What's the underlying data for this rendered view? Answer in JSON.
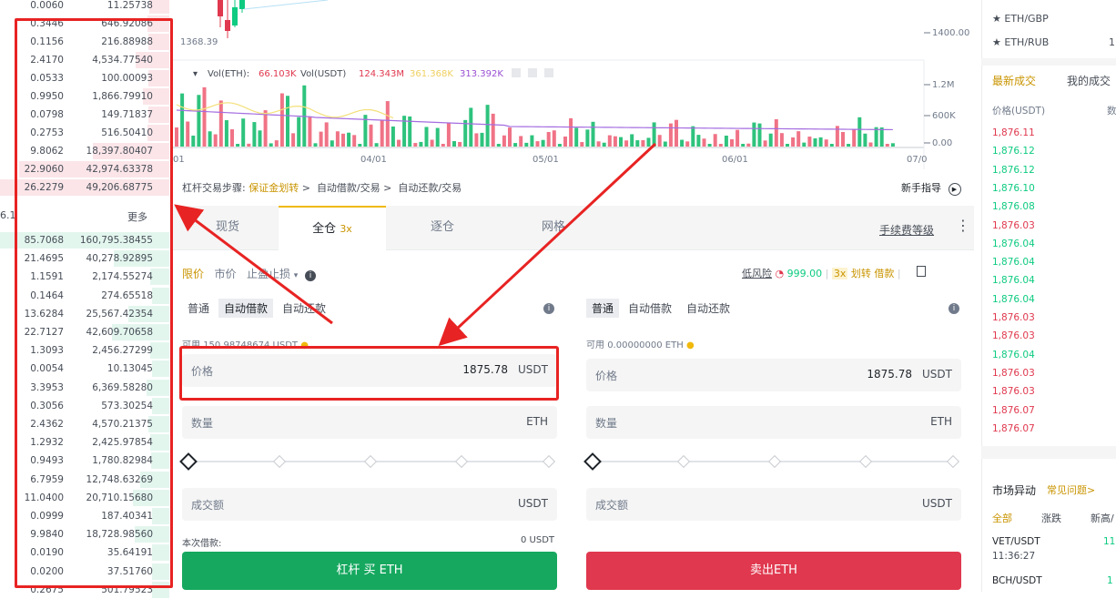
{
  "orderbook": {
    "asks": [
      {
        "amount": "0.0060",
        "total": "11.25738"
      },
      {
        "amount": "0.3446",
        "total": "646.92086"
      },
      {
        "amount": "0.1156",
        "total": "216.88988"
      },
      {
        "amount": "2.4170",
        "total": "4,534.77540"
      },
      {
        "amount": "0.0533",
        "total": "100.00093"
      },
      {
        "amount": "0.9950",
        "total": "1,866.79910"
      },
      {
        "amount": "0.0798",
        "total": "149.71837"
      },
      {
        "amount": "0.2753",
        "total": "516.50410"
      },
      {
        "amount": "9.8062",
        "total": "18,397.80407"
      },
      {
        "amount": "22.9060",
        "total": "42,974.63378"
      },
      {
        "amount": "26.2279",
        "total": "49,206.68775"
      }
    ],
    "mid_fragment": "6.1",
    "more_label": "更多",
    "bids": [
      {
        "amount": "85.7068",
        "total": "160,795.38455"
      },
      {
        "amount": "21.4695",
        "total": "40,278.92895"
      },
      {
        "amount": "1.1591",
        "total": "2,174.55274"
      },
      {
        "amount": "0.1464",
        "total": "274.65518"
      },
      {
        "amount": "13.6284",
        "total": "25,567.42354"
      },
      {
        "amount": "22.7127",
        "total": "42,609.70658"
      },
      {
        "amount": "1.3093",
        "total": "2,456.27299"
      },
      {
        "amount": "0.0054",
        "total": "10.13045"
      },
      {
        "amount": "3.3953",
        "total": "6,369.58280"
      },
      {
        "amount": "0.3056",
        "total": "573.30254"
      },
      {
        "amount": "2.4362",
        "total": "4,570.21375"
      },
      {
        "amount": "1.2932",
        "total": "2,425.97854"
      },
      {
        "amount": "0.9493",
        "total": "1,780.82984"
      },
      {
        "amount": "6.7959",
        "total": "12,748.63269"
      },
      {
        "amount": "11.0400",
        "total": "20,710.15680"
      },
      {
        "amount": "0.0999",
        "total": "187.40341"
      },
      {
        "amount": "9.9840",
        "total": "18,728.98560"
      },
      {
        "amount": "0.0190",
        "total": "35.64191"
      },
      {
        "amount": "0.0200",
        "total": "37.51760"
      },
      {
        "amount": "0.2675",
        "total": "501.79523"
      }
    ]
  },
  "chart": {
    "low_label": "1368.39",
    "price_tick": "1400.00",
    "vol_ticks": [
      "1.2M",
      "600K",
      "0.00"
    ],
    "vol_legend": {
      "eth_label": "Vol(ETH):",
      "eth_value": "66.103K",
      "usdt_label": "Vol(USDT)",
      "usdt_value": "124.343M",
      "ma_value_1": "361.368K",
      "ma_value_2": "313.392K"
    },
    "date_ticks": [
      "01",
      "04/01",
      "05/01",
      "06/01",
      "07/0"
    ]
  },
  "steps": {
    "prefix": "杠杆交易步骤:",
    "step1": "保证金划转",
    "sep": ">",
    "step2": "自动借款/交易",
    "step3": "自动还款/交易",
    "guide": "新手指导"
  },
  "tabs": {
    "items": [
      "现货",
      "全仓",
      "逐仓",
      "网格"
    ],
    "leverage": "3x",
    "fee_label": "手续费等级"
  },
  "order_types": {
    "limit": "限价",
    "market": "市价",
    "stop": "止盈止损"
  },
  "risk": {
    "label": "低风险",
    "value": "999.00",
    "lev": "3x",
    "transfer": "划转",
    "borrow": "借款"
  },
  "buy": {
    "modes": [
      "普通",
      "自动借款",
      "自动还款"
    ],
    "available_label": "可用",
    "available_value": "150.98748674 USDT",
    "price_label": "价格",
    "price_value": "1875.78",
    "price_unit": "USDT",
    "qty_label": "数量",
    "qty_unit": "ETH",
    "total_label": "成交额",
    "total_unit": "USDT",
    "borrow_label": "本次借款:",
    "borrow_value": "0 USDT",
    "button": "杠杆 买 ETH"
  },
  "sell": {
    "modes": [
      "普通",
      "自动借款",
      "自动还款"
    ],
    "available_label": "可用",
    "available_value": "0.00000000 ETH",
    "price_label": "价格",
    "price_value": "1875.78",
    "price_unit": "USDT",
    "qty_label": "数量",
    "qty_unit": "ETH",
    "total_label": "成交额",
    "total_unit": "USDT",
    "button": "卖出ETH"
  },
  "right": {
    "pairs": [
      "ETH/GBP",
      "ETH/RUB"
    ],
    "pair_fragment": "1",
    "tab_latest": "最新成交",
    "tab_mine": "我的成交",
    "col_price": "价格(USDT)",
    "col_fragment": "数",
    "trades": [
      {
        "p": "1,876.11",
        "dir": "dn"
      },
      {
        "p": "1,876.12",
        "dir": "up"
      },
      {
        "p": "1,876.12",
        "dir": "up"
      },
      {
        "p": "1,876.10",
        "dir": "up"
      },
      {
        "p": "1,876.08",
        "dir": "up"
      },
      {
        "p": "1,876.03",
        "dir": "dn"
      },
      {
        "p": "1,876.04",
        "dir": "up"
      },
      {
        "p": "1,876.04",
        "dir": "up"
      },
      {
        "p": "1,876.04",
        "dir": "up"
      },
      {
        "p": "1,876.04",
        "dir": "up"
      },
      {
        "p": "1,876.03",
        "dir": "dn"
      },
      {
        "p": "1,876.03",
        "dir": "dn"
      },
      {
        "p": "1,876.04",
        "dir": "up"
      },
      {
        "p": "1,876.03",
        "dir": "dn"
      },
      {
        "p": "1,876.03",
        "dir": "dn"
      },
      {
        "p": "1,876.07",
        "dir": "dn"
      },
      {
        "p": "1,876.07",
        "dir": "dn"
      }
    ],
    "movers_title": "市场异动",
    "movers_help": "常见问题>",
    "movers_tabs": [
      "全部",
      "涨跌",
      "新高/"
    ],
    "mover1_pair": "VET/USDT",
    "mover1_time": "11:36:27",
    "mover1_frag": "11",
    "mover2_pair": "BCH/USDT",
    "mover2_frag": "1"
  },
  "colors": {
    "up": "#0ecb81",
    "down": "#e0384e",
    "accent": "#f0b90b",
    "annotation": "#e82323"
  }
}
